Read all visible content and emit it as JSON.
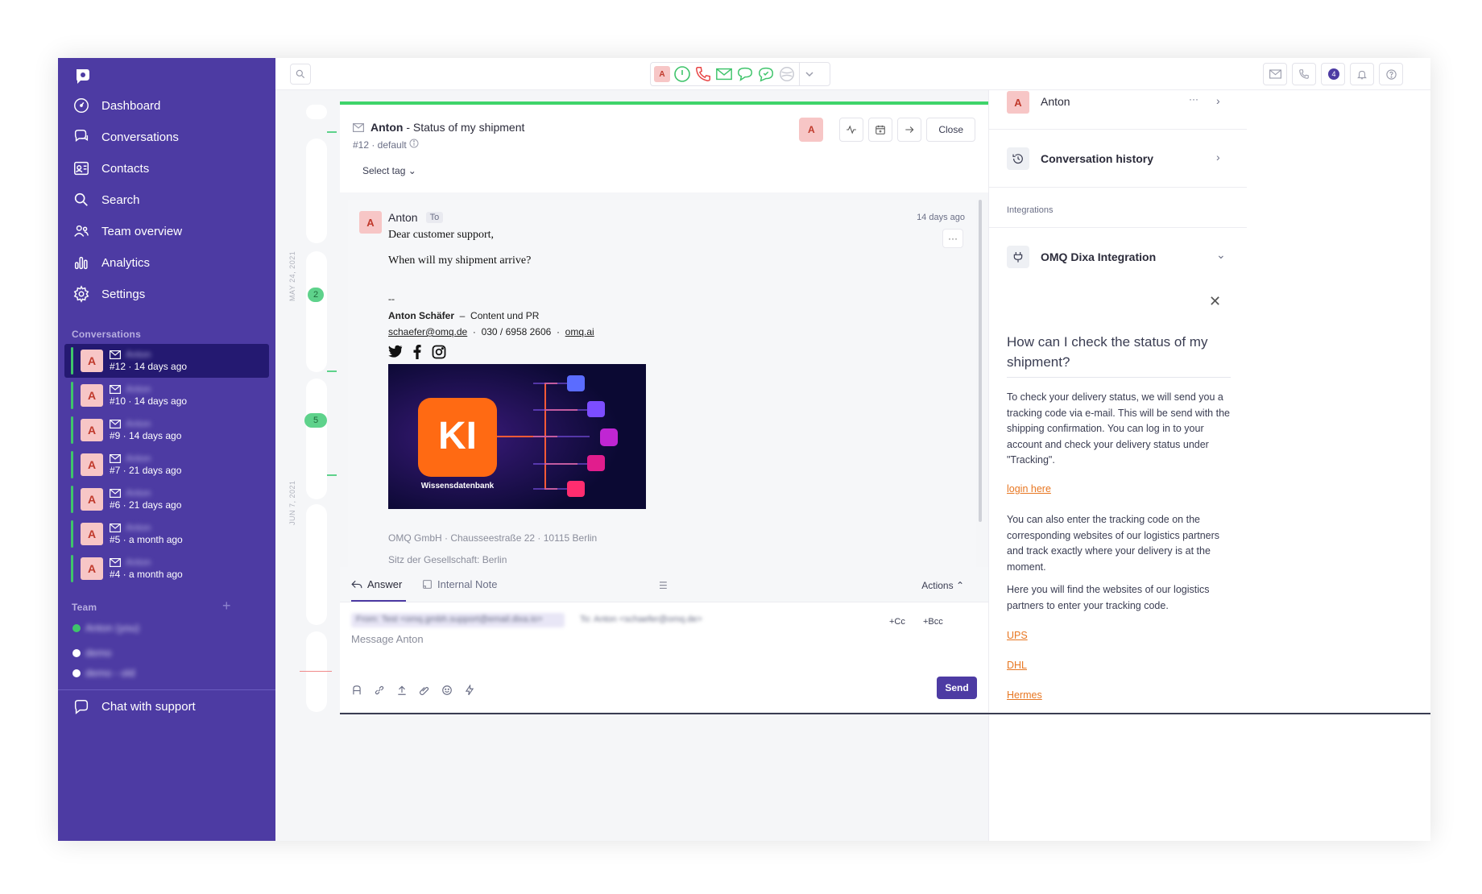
{
  "sidebar": {
    "nav": [
      {
        "label": "Dashboard",
        "icon": "dashboard-icon"
      },
      {
        "label": "Conversations",
        "icon": "conversations-icon"
      },
      {
        "label": "Contacts",
        "icon": "contacts-icon"
      },
      {
        "label": "Search",
        "icon": "search-icon"
      },
      {
        "label": "Team overview",
        "icon": "team-icon"
      },
      {
        "label": "Analytics",
        "icon": "analytics-icon"
      },
      {
        "label": "Settings",
        "icon": "settings-icon"
      }
    ],
    "conversations_label": "Conversations",
    "conversations": [
      {
        "avatar": "A",
        "name": "Anton",
        "meta": "#12 · 14 days ago"
      },
      {
        "avatar": "A",
        "name": "Anton",
        "meta": "#10 · 14 days ago"
      },
      {
        "avatar": "A",
        "name": "Anton",
        "meta": "#9 · 14 days ago"
      },
      {
        "avatar": "A",
        "name": "Anton",
        "meta": "#7 · 21 days ago"
      },
      {
        "avatar": "A",
        "name": "Anton",
        "meta": "#6 · 21 days ago"
      },
      {
        "avatar": "A",
        "name": "Anton",
        "meta": "#5 · a month ago"
      },
      {
        "avatar": "A",
        "name": "Anton",
        "meta": "#4 · a month ago"
      }
    ],
    "team_label": "Team",
    "team": [
      {
        "name": "Anton (you)",
        "status_color": "#3fc46b"
      },
      {
        "name": "demo",
        "status_color": "#ffffff"
      },
      {
        "name": "demo - old",
        "status_color": "#ffffff"
      }
    ],
    "chat_support": "Chat with support"
  },
  "topbar": {
    "channel_avatar": "A",
    "notification_count": "4"
  },
  "timeline": {
    "dates": [
      "MAY 24, 2021",
      "JUN 7, 2021"
    ],
    "counts": [
      "2",
      "5"
    ]
  },
  "conversation": {
    "contact": "Anton",
    "subject": "- Status of my shipment",
    "meta": "#12 · default",
    "select_tag": "Select tag",
    "avatar": "A",
    "close_label": "Close"
  },
  "message": {
    "avatar": "A",
    "from": "Anton",
    "to_label": "To",
    "time": "14 days ago",
    "greeting": "Dear customer support,",
    "body": "When will my shipment arrive?",
    "dashes": "--",
    "sig_name": "Anton Schäfer",
    "sig_role": "Content und PR",
    "sig_email": "schaefer@omq.de",
    "sig_phone": "030 / 6958 2606",
    "sig_site": "omq.ai",
    "banner_title": "KI",
    "banner_caption": "Wissensdatenbank",
    "company_line": "OMQ GmbH · Chausseestraße 22 · 10115 Berlin",
    "seat_line": "Sitz der Gesellschaft: Berlin"
  },
  "composer": {
    "tab_answer": "Answer",
    "tab_note": "Internal Note",
    "actions": "Actions",
    "from_blur": "From: Test <omq.gmbh.support@email.dixa.io>",
    "to_blur": "To: Anton <schaefer@omq.de>",
    "cc": "+Cc",
    "bcc": "+Bcc",
    "placeholder": "Message Anton",
    "send": "Send"
  },
  "right_panel": {
    "contact_name": "Anton",
    "contact_avatar": "A",
    "history": "Conversation history",
    "integrations_label": "Integrations",
    "integration_name": "OMQ Dixa Integration",
    "question": "How can I check the status of my shipment?",
    "answer_p1": "To check your delivery status, we will send you a tracking code via e-mail. This will be send with the shipping confirmation. You can log in to your account and check your delivery status under \"Tracking\".",
    "login_link": "login here",
    "answer_p2": "You can also enter the tracking code on the corresponding websites of our logistics partners and track exactly where your delivery is at the moment.",
    "answer_p3": "Here you will find the websites of our logistics partners to enter your tracking code.",
    "links": [
      "UPS",
      "DHL",
      "Hermes"
    ]
  },
  "colors": {
    "sidebar_bg": "#4d3ba3",
    "accent_green": "#3ed46a",
    "link_orange": "#e87722",
    "send_button": "#4d3ba3"
  }
}
